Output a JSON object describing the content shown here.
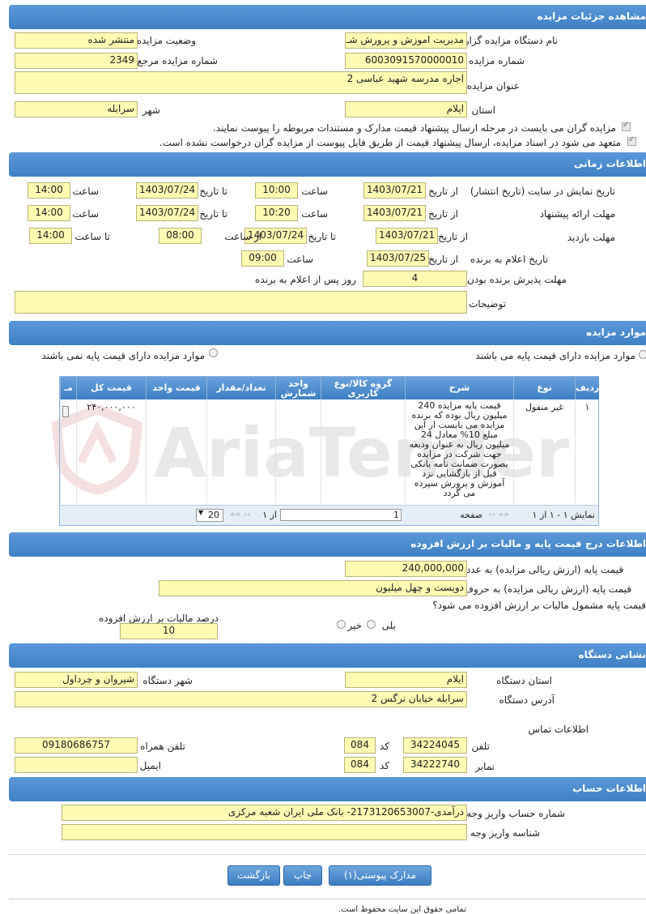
{
  "sections": {
    "details": "مشاهده جزئیات مزایده",
    "timing": "اطلاعات زمانی",
    "items": "موارد مزایده",
    "price": "اطلاعات درج قیمت پایه و مالیات بر ارزش افزوده",
    "address": "نشانی دستگاه",
    "account": "اطلاعات حساب"
  },
  "details": {
    "org_label": "نام دستگاه مزایده گزار",
    "org_value": "مدیریت اموزش و پرورش شـ",
    "status_label": "وضعیت مزایده",
    "status_value": "منتشر شده",
    "number_label": "شماره مزایده",
    "number_value": "6003091570000010",
    "ref_label": "شماره مزایده مرجع",
    "ref_value": "2349",
    "title_label": "عنوان مزایده",
    "title_value": "اجاره مدرسه شهید عباسی 2",
    "province_label": "استان",
    "province_value": "ایلام",
    "city_label": "شهر",
    "city_value": "سرابله",
    "check1": "مزایده گران می بایست در مرحله ارسال پیشنهاد قیمت مدارک و مستندات مربوطه را پیوست نمایند.",
    "check2": "متعهد می شود در اسناد مزایده، ارسال پیشنهاد قیمت از طریق فایل پیوست از مزایده گران درخواست نشده است."
  },
  "timing": {
    "row1_label": "تاریخ نمایش در سایت (تاریخ انتشار)",
    "row2_label": "مهلت ارائه پیشنهاد",
    "row3_label": "مهلت بازدید",
    "row4_label": "تاریخ اعلام به برنده",
    "row5_label": "مهلت پذیرش برنده بودن",
    "desc_label": "توضیحات",
    "from_date": "از تاریخ",
    "to_date": "تا تاریخ",
    "time": "ساعت",
    "from_time": "از ساعت",
    "to_time": "تا ساعت",
    "days_after": "روز پس از اعلام به برنده",
    "r1_from": "1403/07/21",
    "r1_from_time": "10:00",
    "r1_to": "1403/07/24",
    "r1_to_time": "14:00",
    "r2_from": "1403/07/21",
    "r2_from_time": "10:20",
    "r2_to": "1403/07/24",
    "r2_to_time": "14:00",
    "r3_from": "1403/07/21",
    "r3_to": "1403/07/24",
    "r3_from_time": "08:00",
    "r3_to_time": "14:00",
    "r4_date": "1403/07/25",
    "r4_time": "09:00",
    "r5_days": "4"
  },
  "items": {
    "radio_with": "موارد مزایده دارای قیمت پایه می باشند",
    "radio_without": "موارد مزایده دارای قیمت پایه نمی باشند",
    "headers": {
      "row": "ردیف",
      "type": "نوع",
      "desc": "شرح",
      "group": "گروه کالا/نوع کاربری",
      "unit": "واحد شمارش",
      "qty": "تعداد/مقدار",
      "unit_price": "قیمت واحد",
      "total": "قیمت کل",
      "more": "مـ"
    },
    "row": {
      "num": "١",
      "type": "غیر منقول",
      "desc": "قیمت پایه مزایده 240 میلیون ریال بوده که برنده مزایده می بایست از این مبلغ 10% معادل 24 میلیون ریال به عنوان ودیعه جهت شرکت در مزایده بصورت ضمانت نامه بانکی قبل از بازگشایی نزد آموزش و پرورش سپرده می گردد",
      "total": "۲۴۰,۰۰۰,۰۰۰"
    },
    "pager": {
      "showing": "نمایش ١ - ١ از ١",
      "page_label": "صفحه",
      "page_value": "1",
      "of": "از ١",
      "page_size": "20"
    }
  },
  "price": {
    "base_num_label": "قیمت پایه (ارزش ریالی مزایده) به عدد",
    "base_num_value": "240,000,000",
    "base_txt_label": "قیمت پایه (ارزش ریالی مزایده) به حروف",
    "base_txt_value": "دویست و چهل میلیون",
    "vat_question": "قیمت پایه مشمول مالیات بر ارزش افزوده می شود؟",
    "yes": "بلی",
    "no": "خیر",
    "vat_percent_label": "درصد مالیات بر ارزش افزوده",
    "vat_percent_value": "10"
  },
  "address": {
    "province_label": "استان دستگاه",
    "province_value": "ایلام",
    "city_label": "شهر دستگاه",
    "city_value": "شیروان و چرداول",
    "addr_label": "آدرس دستگاه",
    "addr_value": "سرابله خیابان نرگس 2",
    "contact_label": "اطلاعات تماس",
    "phone_label": "تلفن",
    "phone_value": "34224045",
    "code_label": "کد",
    "phone_code": "084",
    "mobile_label": "تلفن همراه",
    "mobile_value": "09180686757",
    "fax_label": "نمابر",
    "fax_value": "34222740",
    "fax_code": "084",
    "email_label": "ایمیل",
    "email_value": ""
  },
  "account": {
    "acc_label": "شماره حساب واریز وجه",
    "acc_value": "درآمدی-2173120653007- بانک ملی ایران شعبه مرکزی",
    "id_label": "شناسه واریز وجه",
    "id_value": ""
  },
  "buttons": {
    "attachments": "مدارک پیوستی(١)",
    "print": "چاپ",
    "back": "بازگشت"
  },
  "footer": "تمامی حقوق این سایت محفوظ است.",
  "watermark": "AriaTender"
}
